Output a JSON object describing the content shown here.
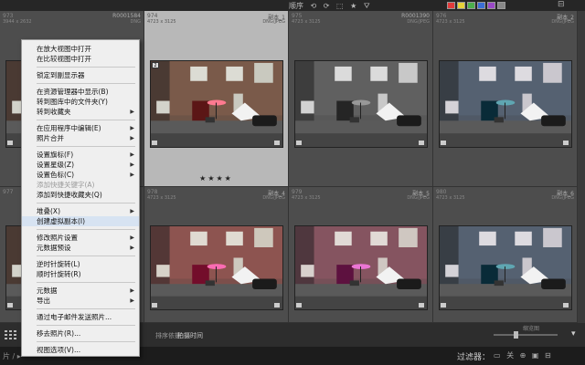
{
  "topbar": {
    "tools": [
      "顺序",
      "⟲",
      "⟳",
      "⬚",
      "★",
      "⛛"
    ],
    "swatches": [
      "#e23b3b",
      "#e8d23a",
      "#4cb04c",
      "#3c6fd6",
      "#9a49c6",
      "#888888"
    ],
    "corner_icon": "⊟"
  },
  "grid": {
    "cells": [
      {
        "idx": "973",
        "dim": "3944 x 2632",
        "name": "R0001584",
        "type": "DNG"
      },
      {
        "idx": "974",
        "dim": "4723 x 3125",
        "name": "副本_1",
        "type": "DNG/JPEG",
        "stars": "★★★★",
        "selected": true
      },
      {
        "idx": "975",
        "dim": "4723 x 3125",
        "name": "R0001390",
        "type": "DNG/JPEG"
      },
      {
        "idx": "976",
        "dim": "4723 x 3125",
        "name": "副本_2",
        "type": "DNG/JPEG"
      },
      {
        "idx": "977",
        "dim": "",
        "name": "",
        "type": ""
      },
      {
        "idx": "978",
        "dim": "4723 x 3125",
        "name": "副本_4",
        "type": "DNG/JPEG"
      },
      {
        "idx": "979",
        "dim": "4723 x 3125",
        "name": "副本_5",
        "type": "DNG/JPEG"
      },
      {
        "idx": "980",
        "dim": "4723 x 3125",
        "name": "副本_6",
        "type": "DNG/JPEG"
      }
    ],
    "badge": "2"
  },
  "bottom": {
    "sort_label": "排序依据：",
    "sort_value": "拍摄时间",
    "thumb_label": "缩览图",
    "dropdown": "▾"
  },
  "filmbar": {
    "left_text": "片 / ▸",
    "filter_label": "过滤器：",
    "filter_icons": "▭ 关 ⊕ ▣ ⊟"
  },
  "menu": {
    "items": [
      {
        "label": "在放大视图中打开"
      },
      {
        "label": "在比较视图中打开"
      },
      {
        "sep": true
      },
      {
        "label": "锁定到副显示器"
      },
      {
        "sep": true
      },
      {
        "label": "在资源管理器中显示(B)"
      },
      {
        "label": "转到图库中的文件夹(Y)"
      },
      {
        "label": "转到收藏夹",
        "arrow": true
      },
      {
        "sep": true
      },
      {
        "label": "在应用程序中编辑(E)",
        "arrow": true
      },
      {
        "label": "照片合并",
        "arrow": true
      },
      {
        "sep": true
      },
      {
        "label": "设置旗标(F)",
        "arrow": true
      },
      {
        "label": "设置星级(Z)",
        "arrow": true
      },
      {
        "label": "设置色标(C)",
        "arrow": true
      },
      {
        "label": "添加快捷关键字(A)",
        "disabled": true
      },
      {
        "label": "添加到快捷收藏夹(Q)"
      },
      {
        "sep": true
      },
      {
        "label": "堆叠(X)",
        "arrow": true
      },
      {
        "label": "创建虚拟副本(I)",
        "highlight": true
      },
      {
        "sep": true
      },
      {
        "label": "修改照片设置",
        "arrow": true
      },
      {
        "label": "元数据预设",
        "arrow": true
      },
      {
        "sep": true
      },
      {
        "label": "逆时针旋转(L)"
      },
      {
        "label": "顺时针旋转(R)"
      },
      {
        "sep": true
      },
      {
        "label": "元数据",
        "arrow": true
      },
      {
        "label": "导出",
        "arrow": true
      },
      {
        "sep": true
      },
      {
        "label": "通过电子邮件发送照片..."
      },
      {
        "sep": true
      },
      {
        "label": "移去照片(R)..."
      },
      {
        "sep": true
      },
      {
        "label": "视图选项(V)..."
      }
    ]
  }
}
